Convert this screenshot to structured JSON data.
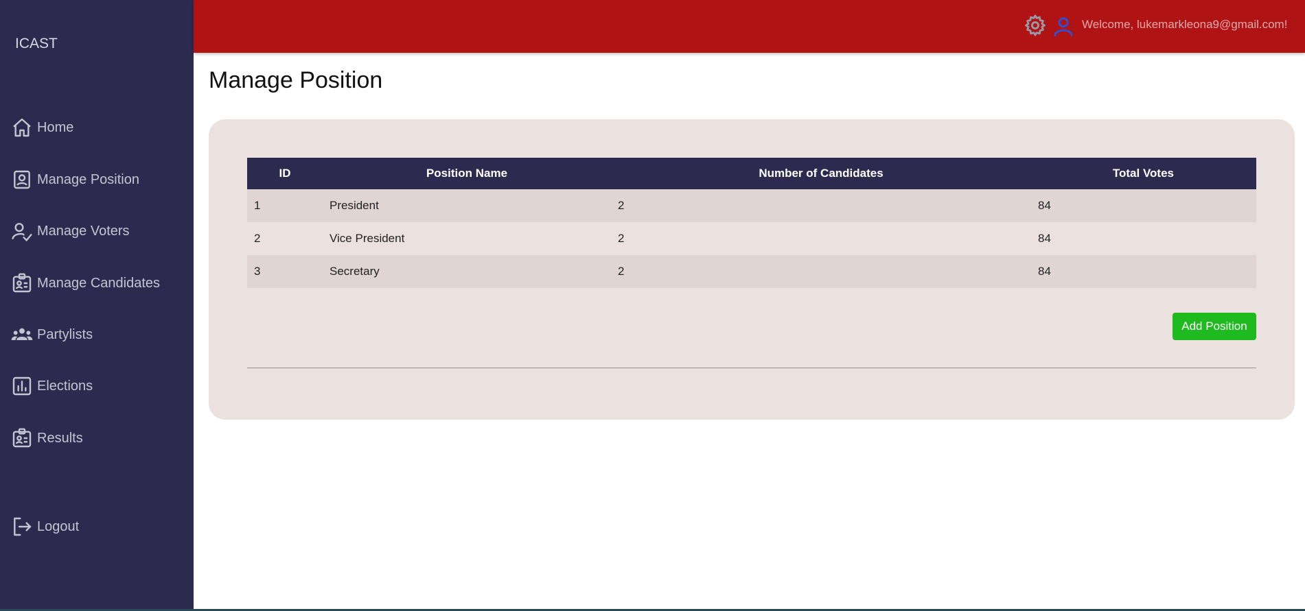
{
  "sidebar": {
    "brand": "ICAST",
    "items": [
      {
        "label": "Home",
        "icon": "home-icon"
      },
      {
        "label": "Manage Position",
        "icon": "position-badge-icon"
      },
      {
        "label": "Manage Voters",
        "icon": "user-check-icon"
      },
      {
        "label": "Manage Candidates",
        "icon": "id-card-icon"
      },
      {
        "label": "Partylists",
        "icon": "group-icon"
      },
      {
        "label": "Elections",
        "icon": "bar-chart-icon"
      },
      {
        "label": "Results",
        "icon": "id-card-icon"
      }
    ],
    "logout": {
      "label": "Logout",
      "icon": "logout-icon"
    }
  },
  "header": {
    "welcome": "Welcome, lukemarkleona9@gmail.com!",
    "settings_icon": "gear-icon",
    "user_icon": "user-icon"
  },
  "main": {
    "title": "Manage Position",
    "table": {
      "columns": [
        "ID",
        "Position Name",
        "Number of Candidates",
        "Total Votes"
      ],
      "rows": [
        [
          "1",
          "President",
          "2",
          "84"
        ],
        [
          "2",
          "Vice President",
          "2",
          "84"
        ],
        [
          "3",
          "Secretary",
          "2",
          "84"
        ]
      ]
    },
    "add_button": "Add Position"
  },
  "colors": {
    "sidebar": "#2c2b4f",
    "topbar": "#b01314",
    "card": "#ebe1de",
    "add_button": "#1fba1f"
  }
}
